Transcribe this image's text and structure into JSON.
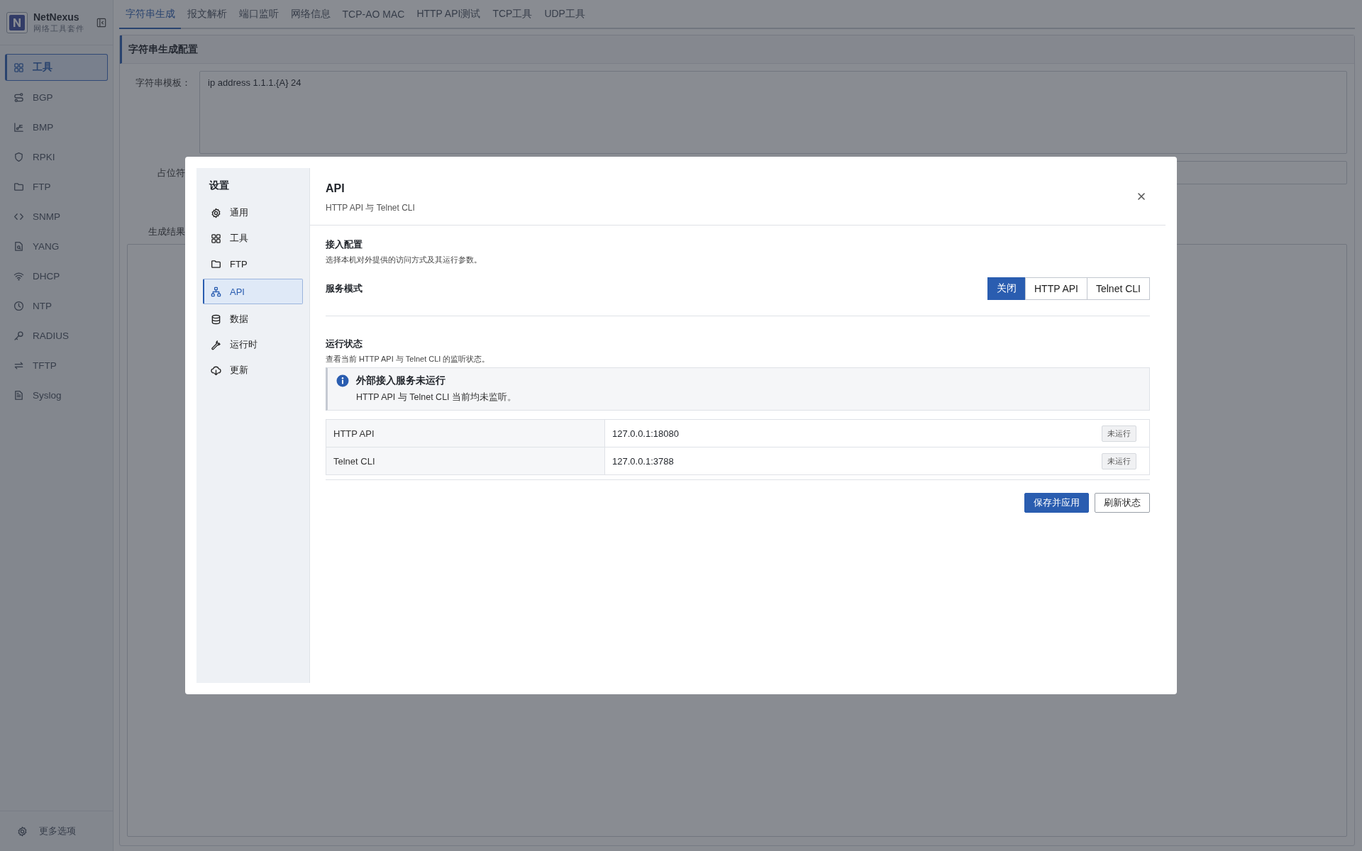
{
  "app": {
    "name": "NetNexus",
    "subtitle": "网络工具套件"
  },
  "sidebar": {
    "items": [
      {
        "label": "工具",
        "selected": true
      },
      {
        "label": "BGP",
        "selected": false
      },
      {
        "label": "BMP",
        "selected": false
      },
      {
        "label": "RPKI",
        "selected": false
      },
      {
        "label": "FTP",
        "selected": false
      },
      {
        "label": "SNMP",
        "selected": false
      },
      {
        "label": "YANG",
        "selected": false
      },
      {
        "label": "DHCP",
        "selected": false
      },
      {
        "label": "NTP",
        "selected": false
      },
      {
        "label": "RADIUS",
        "selected": false
      },
      {
        "label": "TFTP",
        "selected": false
      },
      {
        "label": "Syslog",
        "selected": false
      }
    ],
    "footer": "更多选项"
  },
  "tabs": [
    {
      "label": "字符串生成",
      "selected": true
    },
    {
      "label": "报文解析",
      "selected": false
    },
    {
      "label": "端口监听",
      "selected": false
    },
    {
      "label": "网络信息",
      "selected": false
    },
    {
      "label": "TCP-AO MAC",
      "selected": false
    },
    {
      "label": "HTTP API测试",
      "selected": false
    },
    {
      "label": "TCP工具",
      "selected": false
    },
    {
      "label": "UDP工具",
      "selected": false
    }
  ],
  "panel": {
    "title": "字符串生成配置",
    "template_label": "字符串模板：",
    "template_value": "ip address 1.1.1.{A} 24",
    "placeholder_label": "占位符",
    "result_label": "生成结果"
  },
  "dialog": {
    "nav_title": "设置",
    "nav": [
      {
        "label": "通用",
        "selected": false
      },
      {
        "label": "工具",
        "selected": false
      },
      {
        "label": "FTP",
        "selected": false
      },
      {
        "label": "API",
        "selected": true
      },
      {
        "label": "数据",
        "selected": false
      },
      {
        "label": "运行时",
        "selected": false
      },
      {
        "label": "更新",
        "selected": false
      }
    ],
    "title": "API",
    "subtitle": "HTTP API 与 Telnet CLI",
    "access": {
      "title": "接入配置",
      "description": "选择本机对外提供的访问方式及其运行参数。"
    },
    "mode_label": "服务模式",
    "modes": [
      {
        "label": "关闭",
        "selected": true
      },
      {
        "label": "HTTP API",
        "selected": false
      },
      {
        "label": "Telnet CLI",
        "selected": false
      }
    ],
    "status": {
      "title": "运行状态",
      "description": "查看当前 HTTP API 与 Telnet CLI 的监听状态。"
    },
    "alert": {
      "title": "外部接入服务未运行",
      "text": "HTTP API 与 Telnet CLI 当前均未监听。"
    },
    "services": [
      {
        "name": "HTTP API",
        "address": "127.0.0.1:18080",
        "status": "未运行"
      },
      {
        "name": "Telnet CLI",
        "address": "127.0.0.1:3788",
        "status": "未运行"
      }
    ],
    "buttons": [
      {
        "label": "保存并应用",
        "kind": "primary"
      },
      {
        "label": "刷新状态",
        "kind": "secondary"
      }
    ]
  }
}
